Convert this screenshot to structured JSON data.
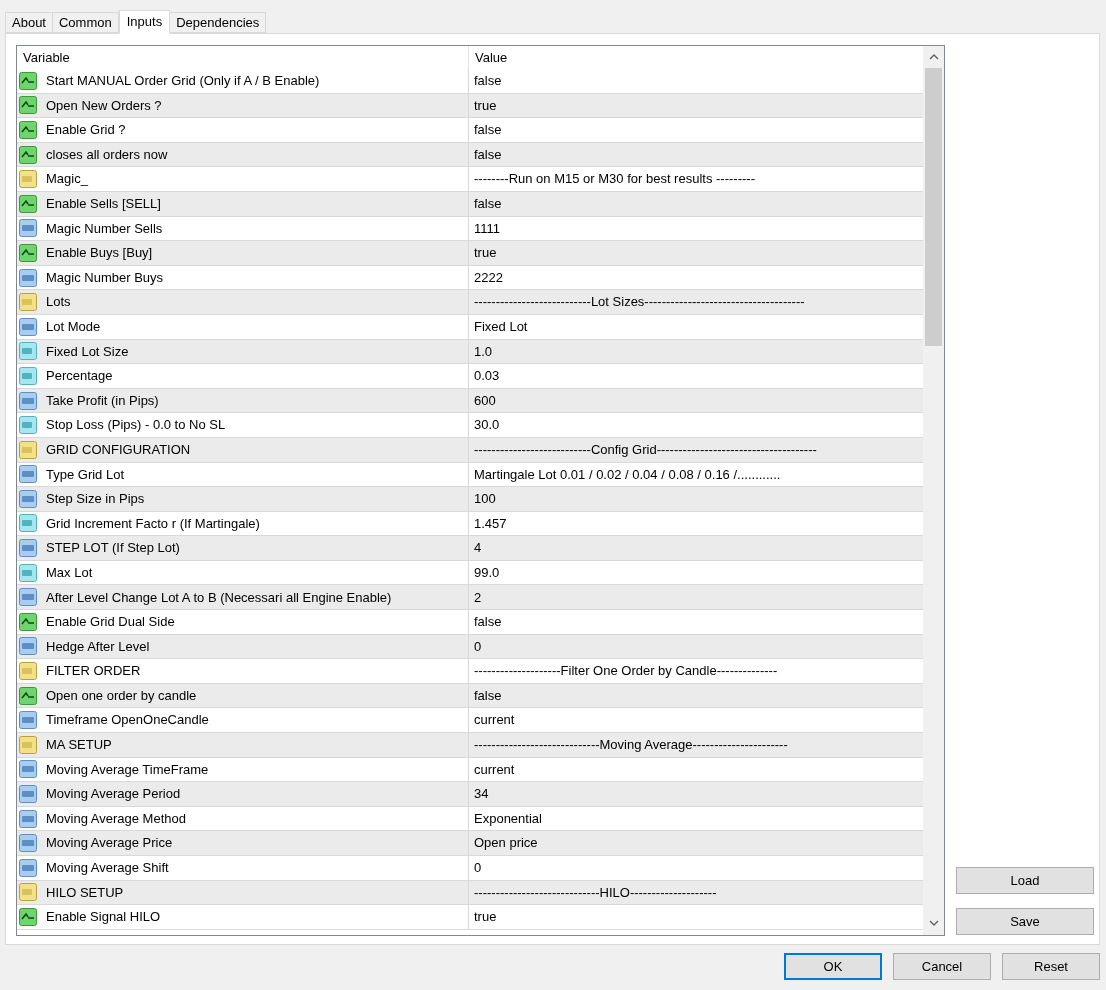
{
  "tabs": [
    {
      "label": "About",
      "selected": false
    },
    {
      "label": "Common",
      "selected": false
    },
    {
      "label": "Inputs",
      "selected": true
    },
    {
      "label": "Dependencies",
      "selected": false
    }
  ],
  "table": {
    "columns": [
      "Variable",
      "Value"
    ],
    "rows": [
      {
        "kind": "bool",
        "variable": "Start MANUAL Order  Grid  (Only if A / B Enable)",
        "value": "false"
      },
      {
        "kind": "bool",
        "variable": "Open New Orders ?",
        "value": "true"
      },
      {
        "kind": "bool",
        "variable": "Enable Grid ?",
        "value": "false"
      },
      {
        "kind": "bool",
        "variable": "closes all orders now",
        "value": "false"
      },
      {
        "kind": "string",
        "variable": "Magic_",
        "value": "--------Run on M15 or M30 for best results ---------"
      },
      {
        "kind": "bool",
        "variable": "Enable Sells   [SELL]",
        "value": "false"
      },
      {
        "kind": "int",
        "variable": "Magic Number Sells",
        "value": "1111"
      },
      {
        "kind": "bool",
        "variable": "Enable Buys   [Buy]",
        "value": "true"
      },
      {
        "kind": "int",
        "variable": "Magic Number Buys",
        "value": "2222"
      },
      {
        "kind": "string",
        "variable": "Lots",
        "value": "---------------------------Lot Sizes-------------------------------------"
      },
      {
        "kind": "int",
        "variable": "Lot Mode",
        "value": "Fixed Lot"
      },
      {
        "kind": "double",
        "variable": "Fixed Lot Size",
        "value": "1.0"
      },
      {
        "kind": "double",
        "variable": "Percentage",
        "value": "0.03"
      },
      {
        "kind": "int",
        "variable": "Take Profit (in Pips)",
        "value": "600"
      },
      {
        "kind": "double",
        "variable": "Stop Loss (Pips) - 0.0 to No SL",
        "value": "30.0"
      },
      {
        "kind": "string",
        "variable": "GRID CONFIGURATION",
        "value": "---------------------------Config Grid-------------------------------------"
      },
      {
        "kind": "int",
        "variable": "Type Grid Lot",
        "value": "Martingale Lot  0.01 / 0.02 / 0.04 / 0.08 / 0.16 /............"
      },
      {
        "kind": "int",
        "variable": "Step Size in Pips",
        "value": "100"
      },
      {
        "kind": "double",
        "variable": "Grid Increment Facto r (If Martingale)",
        "value": "1.457"
      },
      {
        "kind": "int",
        "variable": "STEP LOT (If  Step Lot)",
        "value": "4"
      },
      {
        "kind": "double",
        "variable": "Max Lot",
        "value": "99.0"
      },
      {
        "kind": "int",
        "variable": "After Level Change Lot A to B (Necessari all Engine Enable)",
        "value": "2"
      },
      {
        "kind": "bool",
        "variable": "Enable Grid Dual Side",
        "value": "false"
      },
      {
        "kind": "int",
        "variable": "Hedge After Level",
        "value": "0"
      },
      {
        "kind": "string",
        "variable": "FILTER ORDER",
        "value": "--------------------Filter One Order by Candle--------------"
      },
      {
        "kind": "bool",
        "variable": "Open one order by candle",
        "value": "false"
      },
      {
        "kind": "int",
        "variable": "Timeframe OpenOneCandle",
        "value": "current"
      },
      {
        "kind": "string",
        "variable": "MA SETUP",
        "value": "-----------------------------Moving Average----------------------"
      },
      {
        "kind": "int",
        "variable": "Moving Average TimeFrame",
        "value": "current"
      },
      {
        "kind": "int",
        "variable": "Moving Average Period",
        "value": "34"
      },
      {
        "kind": "int",
        "variable": "Moving Average Method",
        "value": "Exponential"
      },
      {
        "kind": "int",
        "variable": "Moving Average Price",
        "value": "Open price"
      },
      {
        "kind": "int",
        "variable": "Moving Average Shift",
        "value": "0"
      },
      {
        "kind": "string",
        "variable": "HILO SETUP",
        "value": "-----------------------------HILO--------------------"
      },
      {
        "kind": "bool",
        "variable": "Enable Signal HILO",
        "value": "true"
      }
    ]
  },
  "side_buttons": [
    "Load",
    "Save"
  ],
  "buttons": [
    {
      "label": "OK",
      "default": true
    },
    {
      "label": "Cancel",
      "default": false
    },
    {
      "label": "Reset",
      "default": false
    }
  ]
}
